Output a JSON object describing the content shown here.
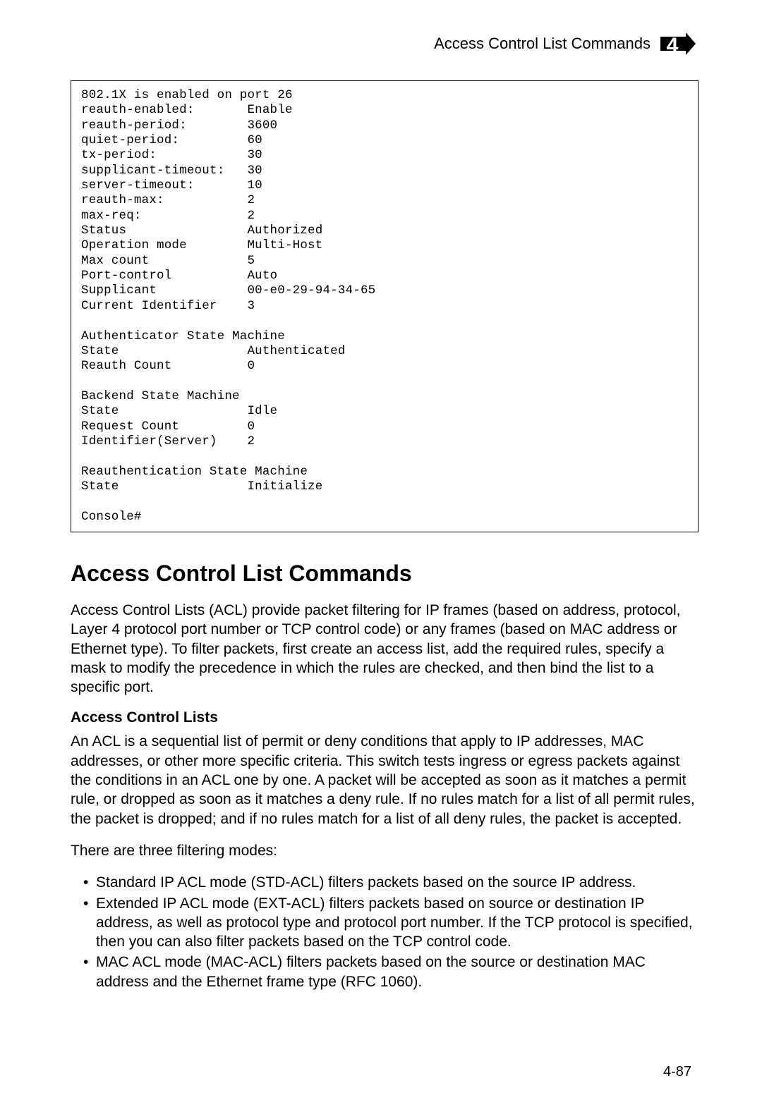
{
  "header": {
    "title": "Access Control List Commands",
    "chapter_number": "4"
  },
  "terminal_output": "802.1X is enabled on port 26\nreauth-enabled:       Enable\nreauth-period:        3600\nquiet-period:         60\ntx-period:            30\nsupplicant-timeout:   30\nserver-timeout:       10\nreauth-max:           2\nmax-req:              2\nStatus                Authorized\nOperation mode        Multi-Host\nMax count             5\nPort-control          Auto\nSupplicant            00-e0-29-94-34-65\nCurrent Identifier    3\n\nAuthenticator State Machine\nState                 Authenticated\nReauth Count          0\n\nBackend State Machine\nState                 Idle\nRequest Count         0\nIdentifier(Server)    2\n\nReauthentication State Machine\nState                 Initialize\n\nConsole#",
  "section": {
    "heading": "Access Control List Commands",
    "intro": "Access Control Lists (ACL) provide packet filtering for IP frames (based on address, protocol, Layer 4 protocol port number or TCP control code) or any frames (based on MAC address or Ethernet type). To filter packets, first create an access list, add the required rules, specify a mask to modify the precedence in which the rules are checked, and then bind the list to a specific port.",
    "subheading": "Access Control Lists",
    "para2": "An ACL is a sequential list of permit or deny conditions that apply to IP addresses, MAC addresses, or other more specific criteria. This switch tests ingress or egress packets against the conditions in an ACL one by one. A packet will be accepted as soon as it matches a permit rule, or dropped as soon as it matches a deny rule. If no rules match for a list of all permit rules, the packet is dropped; and if no rules match for a list of all deny rules, the packet is accepted.",
    "para3": "There are three filtering modes:",
    "bullets": [
      "Standard IP ACL mode (STD-ACL) filters packets based on the source IP address.",
      "Extended IP ACL mode (EXT-ACL) filters packets based on source or destination IP address, as well as protocol type and protocol port number. If the TCP protocol is specified, then you can also filter packets based on the TCP control code.",
      "MAC ACL mode (MAC-ACL) filters packets based on the source or destination MAC address and the Ethernet frame type (RFC 1060)."
    ]
  },
  "page_number": "4-87"
}
